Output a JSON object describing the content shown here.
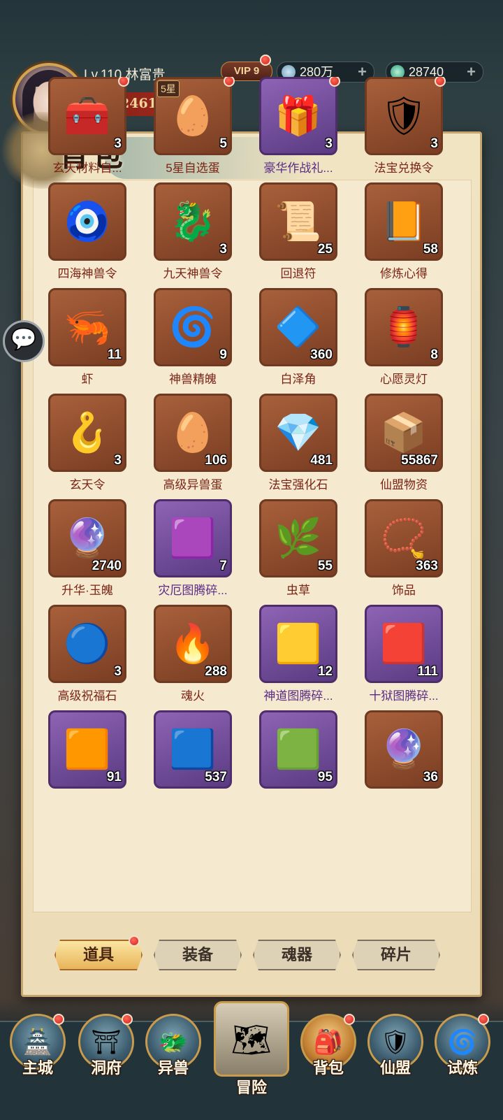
{
  "player": {
    "level_name": "Lv.110 林富贵",
    "vip": "VIP 9",
    "silver": "280万",
    "jade": "28740",
    "power_mark": "战",
    "power": "2461556"
  },
  "page_title": "背包",
  "items": [
    {
      "name": "玄天材料自...",
      "count": "3",
      "glyph": "🧰",
      "rarity": "orange",
      "dot": true
    },
    {
      "name": "5星自选蛋",
      "count": "5",
      "glyph": "🥚",
      "rarity": "orange",
      "dot": true,
      "badge": "5星"
    },
    {
      "name": "豪华作战礼...",
      "count": "3",
      "glyph": "🎁",
      "rarity": "purple",
      "dot": true
    },
    {
      "name": "法宝兑换令",
      "count": "3",
      "glyph": "🛡",
      "rarity": "orange",
      "dot": true
    },
    {
      "name": "四海神兽令",
      "count": "",
      "glyph": "🧿",
      "rarity": "orange",
      "dot": false
    },
    {
      "name": "九天神兽令",
      "count": "3",
      "glyph": "🐉",
      "rarity": "orange",
      "dot": false
    },
    {
      "name": "回退符",
      "count": "25",
      "glyph": "📜",
      "rarity": "orange",
      "dot": false
    },
    {
      "name": "修炼心得",
      "count": "58",
      "glyph": "📙",
      "rarity": "orange",
      "dot": false
    },
    {
      "name": "虾",
      "count": "11",
      "glyph": "🦐",
      "rarity": "orange",
      "dot": false
    },
    {
      "name": "神兽精魄",
      "count": "9",
      "glyph": "🌀",
      "rarity": "orange",
      "dot": false
    },
    {
      "name": "白泽角",
      "count": "360",
      "glyph": "🔷",
      "rarity": "orange",
      "dot": false
    },
    {
      "name": "心愿灵灯",
      "count": "8",
      "glyph": "🏮",
      "rarity": "orange",
      "dot": false
    },
    {
      "name": "玄天令",
      "count": "3",
      "glyph": "🪝",
      "rarity": "orange",
      "dot": false
    },
    {
      "name": "高级异兽蛋",
      "count": "106",
      "glyph": "🥚",
      "rarity": "orange",
      "dot": false
    },
    {
      "name": "法宝强化石",
      "count": "481",
      "glyph": "💎",
      "rarity": "orange",
      "dot": false
    },
    {
      "name": "仙盟物资",
      "count": "55867",
      "glyph": "📦",
      "rarity": "orange",
      "dot": false
    },
    {
      "name": "升华·玉魄",
      "count": "2740",
      "glyph": "🔮",
      "rarity": "orange",
      "dot": false
    },
    {
      "name": "灾厄图腾碎...",
      "count": "7",
      "glyph": "🟪",
      "rarity": "purple",
      "dot": false
    },
    {
      "name": "虫草",
      "count": "55",
      "glyph": "🌿",
      "rarity": "orange",
      "dot": false
    },
    {
      "name": "饰品",
      "count": "363",
      "glyph": "📿",
      "rarity": "orange",
      "dot": false
    },
    {
      "name": "高级祝福石",
      "count": "3",
      "glyph": "🔵",
      "rarity": "orange",
      "dot": false
    },
    {
      "name": "魂火",
      "count": "288",
      "glyph": "🔥",
      "rarity": "orange",
      "dot": false
    },
    {
      "name": "神道图腾碎...",
      "count": "12",
      "glyph": "🟨",
      "rarity": "purple",
      "dot": false
    },
    {
      "name": "十狱图腾碎...",
      "count": "111",
      "glyph": "🟥",
      "rarity": "purple",
      "dot": false
    },
    {
      "name": "",
      "count": "91",
      "glyph": "🟧",
      "rarity": "purple",
      "dot": false
    },
    {
      "name": "",
      "count": "537",
      "glyph": "🟦",
      "rarity": "purple",
      "dot": false
    },
    {
      "name": "",
      "count": "95",
      "glyph": "🟩",
      "rarity": "purple",
      "dot": false
    },
    {
      "name": "",
      "count": "36",
      "glyph": "🔮",
      "rarity": "orange",
      "dot": false
    }
  ],
  "tabs": [
    {
      "label": "道具",
      "active": true,
      "dot": true
    },
    {
      "label": "装备",
      "active": false,
      "dot": false
    },
    {
      "label": "魂器",
      "active": false,
      "dot": false
    },
    {
      "label": "碎片",
      "active": false,
      "dot": false
    }
  ],
  "nav": [
    {
      "label": "主城",
      "glyph": "🏯",
      "dot": true
    },
    {
      "label": "洞府",
      "glyph": "⛩",
      "dot": true
    },
    {
      "label": "异兽",
      "glyph": "🐲",
      "dot": false
    },
    {
      "label": "冒险",
      "glyph": "🗺",
      "dot": false,
      "big": true
    },
    {
      "label": "背包",
      "glyph": "🎒",
      "dot": true,
      "active": true
    },
    {
      "label": "仙盟",
      "glyph": "🛡",
      "dot": false
    },
    {
      "label": "试炼",
      "glyph": "🌀",
      "dot": true
    }
  ],
  "chat_icon": "💬",
  "colors": {
    "panel": "#f1e4c3",
    "slot_orange": "#a8603b",
    "slot_purple": "#8e63b5",
    "accent_red": "#d0231a"
  }
}
